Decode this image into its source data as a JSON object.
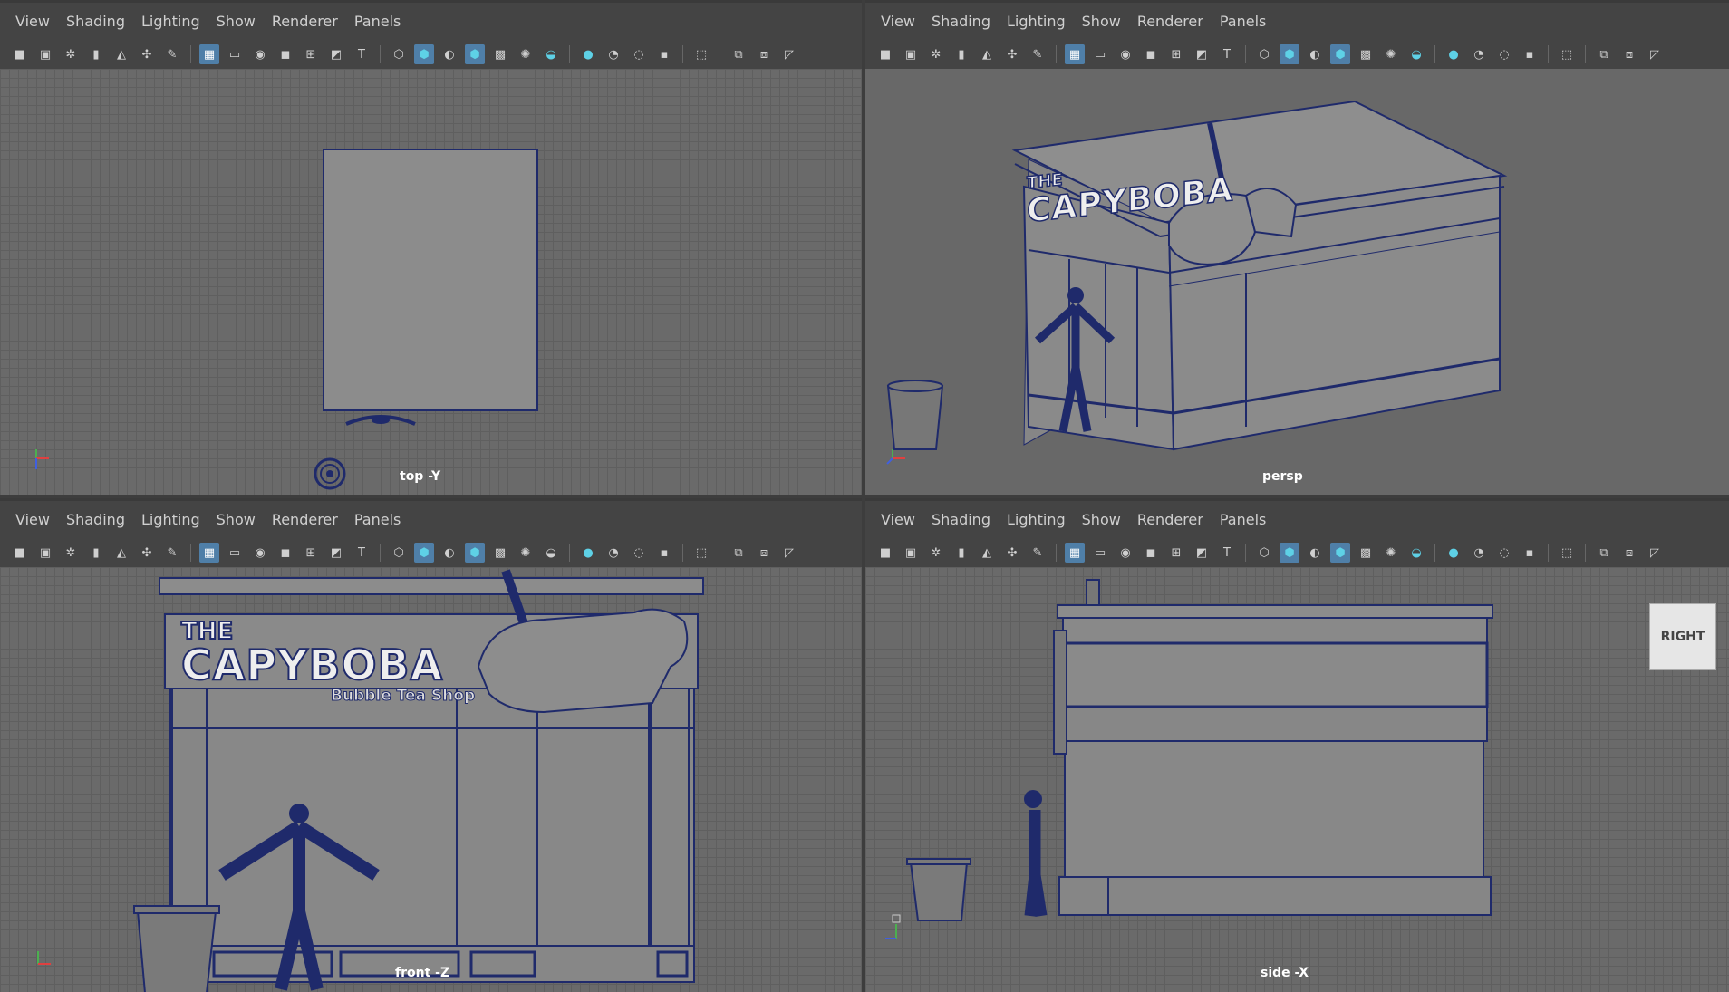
{
  "menu": [
    "View",
    "Shading",
    "Lighting",
    "Show",
    "Renderer",
    "Panels"
  ],
  "viewports": {
    "top": {
      "label": "top -Y"
    },
    "persp": {
      "label": "persp"
    },
    "front": {
      "label": "front -Z"
    },
    "side": {
      "label": "side -X",
      "cube_label": "RIGHT"
    }
  },
  "sign": {
    "title_small": "THE",
    "title_big": "CAPYBOBA",
    "subtitle": "Bubble Tea Shop"
  },
  "colors": {
    "wire": "#1f2a6b",
    "active_icon": "#4f7fa8",
    "cyan": "#5ed1e6"
  }
}
